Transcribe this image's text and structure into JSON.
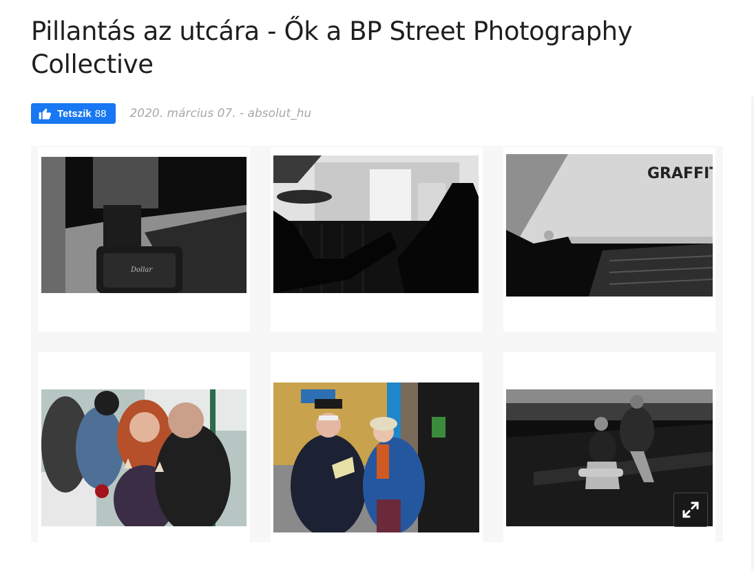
{
  "article": {
    "title": "Pillantás az utcára - Ők a BP Street Photography Collective",
    "like_label": "Tetszik",
    "like_count": "88",
    "byline": "2020. március 07. - absolut_hu"
  },
  "gallery": {
    "images": [
      {
        "subject": "person with Dollar suitcase on sidewalk, black and white",
        "suitcase_text": "Dollar"
      },
      {
        "subject": "silhouettes of people relaxing on a balcony, black and white"
      },
      {
        "subject": "shadow of a person on stairs next to a graffiti wall, black and white",
        "graffiti_text": "GRAFFITI"
      },
      {
        "subject": "young couple eating ice cream on a tram, color"
      },
      {
        "subject": "elderly couple walking past a newsstand, color"
      },
      {
        "subject": "skateboarder on a city street at night, black and white"
      }
    ],
    "expand_icon": "expand-arrows-icon"
  },
  "colors": {
    "like_button": "#1877f2",
    "title_text": "#1e1e1e",
    "byline_text": "#a8a8a8",
    "gallery_bg": "#f7f7f7"
  }
}
